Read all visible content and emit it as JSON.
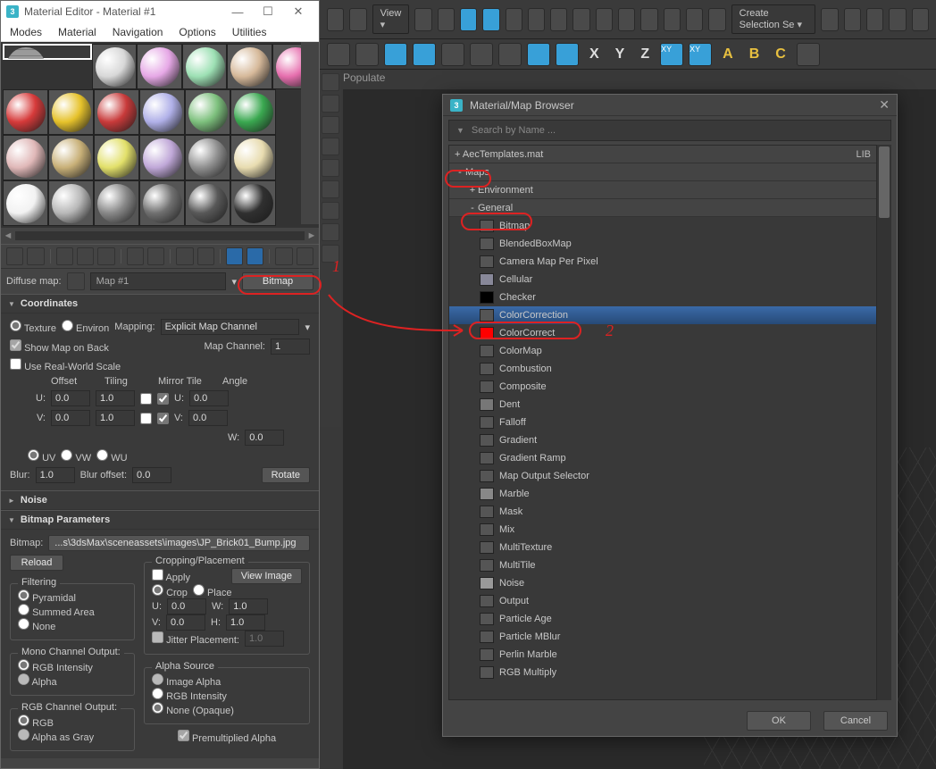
{
  "me": {
    "title": "Material Editor - Material #1",
    "menu": [
      "Modes",
      "Material",
      "Navigation",
      "Options",
      "Utilities"
    ],
    "swatches": [
      [
        "#b0b0b0-brick",
        "#d8d8d8",
        "#e6a8e6",
        "#9de0b4",
        "#d6b99a",
        "#e66fae"
      ],
      [
        "#d63a3a",
        "#e6c22b",
        "#c83a3a",
        "#b0b0e8",
        "#7dc07d",
        "#3aa850"
      ],
      [
        "#e0b8b8",
        "#c8b078",
        "#e2e06a",
        "#c0a8d8",
        "#909090",
        "#e8dcb0"
      ],
      [
        "#f2f2f2",
        "#b8b8b8",
        "#888888",
        "#707070",
        "#585858",
        "#303030"
      ]
    ],
    "slot": {
      "label": "Diffuse map:",
      "name": "Map #1",
      "type": "Bitmap"
    },
    "coords": {
      "title": "Coordinates",
      "texture": "Texture",
      "environ": "Environ",
      "mapping_lbl": "Mapping:",
      "mapping": "Explicit Map Channel",
      "showmap": "Show Map on Back",
      "realworld": "Use Real-World Scale",
      "mapchan_lbl": "Map Channel:",
      "mapchan": "1",
      "hdr_offset": "Offset",
      "hdr_tiling": "Tiling",
      "hdr_mirror": "Mirror Tile",
      "hdr_angle": "Angle",
      "u": "U:",
      "v": "V:",
      "w": "W:",
      "ou": "0.0",
      "ov": "0.0",
      "tu": "1.0",
      "tv": "1.0",
      "au": "0.0",
      "av": "0.0",
      "aw": "0.0",
      "uv": "UV",
      "vw": "VW",
      "wu": "WU",
      "blur_lbl": "Blur:",
      "blur": "1.0",
      "bluroff_lbl": "Blur offset:",
      "bluroff": "0.0",
      "rotate": "Rotate"
    },
    "noise_title": "Noise",
    "bmp": {
      "title": "Bitmap Parameters",
      "path_lbl": "Bitmap:",
      "path": "...s\\3dsMax\\sceneassets\\images\\JP_Brick01_Bump.jpg",
      "reload": "Reload",
      "crop_title": "Cropping/Placement",
      "apply": "Apply",
      "viewimg": "View Image",
      "crop": "Crop",
      "place": "Place",
      "u": "U:",
      "v": "V:",
      "w": "W:",
      "h": "H:",
      "cu": "0.0",
      "cv": "0.0",
      "cw": "1.0",
      "ch": "1.0",
      "jitter_lbl": "Jitter Placement:",
      "jitter": "1.0",
      "filtering": "Filtering",
      "pyr": "Pyramidal",
      "sa": "Summed Area",
      "none": "None",
      "mono": "Mono Channel Output:",
      "rgbi": "RGB Intensity",
      "alpha": "Alpha",
      "rgbout": "RGB Channel Output:",
      "rgb": "RGB",
      "alphagray": "Alpha as Gray",
      "asrc": "Alpha Source",
      "ia": "Image Alpha",
      "ria": "RGB Intensity",
      "noneop": "None (Opaque)",
      "premul": "Premultiplied Alpha"
    }
  },
  "main": {
    "view": "View",
    "selset": "Create Selection Se",
    "populate": "Populate",
    "axes": [
      "X",
      "Y",
      "Z",
      "XY",
      "XY"
    ],
    "abc": [
      "A",
      "B",
      "C"
    ]
  },
  "browser": {
    "title": "Material/Map Browser",
    "search": "Search by Name ...",
    "tpl": "+ AecTemplates.mat",
    "lib": "LIB",
    "maps": "Maps",
    "env": "Environment",
    "general": "General",
    "items": [
      "Bitmap",
      "BlendedBoxMap",
      "Camera Map Per Pixel",
      "Cellular",
      "Checker",
      "ColorCorrection",
      "ColorCorrect",
      "ColorMap",
      "Combustion",
      "Composite",
      "Dent",
      "Falloff",
      "Gradient",
      "Gradient Ramp",
      "Map Output Selector",
      "Marble",
      "Mask",
      "Mix",
      "MultiTexture",
      "MultiTile",
      "Noise",
      "Output",
      "Particle Age",
      "Particle MBlur",
      "Perlin Marble",
      "RGB Multiply"
    ],
    "selected": "ColorCorrection",
    "ok": "OK",
    "cancel": "Cancel"
  },
  "anno": {
    "one": "1",
    "two": "2"
  }
}
